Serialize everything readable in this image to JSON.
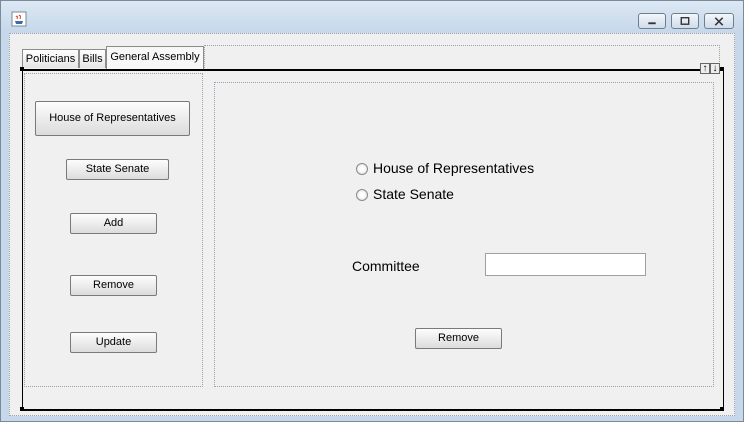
{
  "tabs": [
    {
      "label": "Politicians"
    },
    {
      "label": "Bills"
    },
    {
      "label": "General Assembly"
    }
  ],
  "scroll_arrows": {
    "up": "↑",
    "down": "↓"
  },
  "left_buttons": {
    "house": "House of Representatives",
    "senate": "State Senate",
    "add": "Add",
    "remove": "Remove",
    "update": "Update"
  },
  "chamber_options": [
    {
      "label": "House of Representatives"
    },
    {
      "label": "State Senate"
    }
  ],
  "committee": {
    "label": "Committee",
    "value": ""
  },
  "right_buttons": {
    "remove": "Remove"
  }
}
